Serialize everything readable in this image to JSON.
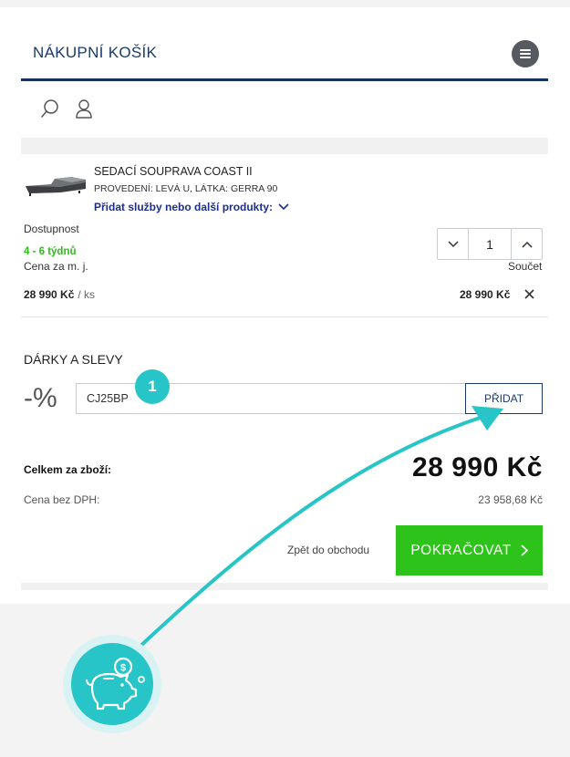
{
  "header": {
    "title": "NÁKUPNÍ KOŠÍK"
  },
  "product": {
    "name": "SEDACÍ SOUPRAVA COAST II",
    "variant": "PROVEDENÍ: LEVÁ U, LÁTKA: GERRA 90",
    "add_services": "Přidat služby nebo další produkty:",
    "availability_label": "Dostupnost",
    "availability_value": "4 - 6 týdnů",
    "quantity": "1",
    "unit_price_label": "Cena za m. j.",
    "unit_price": "28 990 Kč",
    "unit": "/ ks",
    "sum_label": "Součet",
    "sum_value": "28 990 Kč"
  },
  "discounts": {
    "title": "DÁRKY A SLEVY",
    "symbol": "-%",
    "coupon_value": "CJ25BP",
    "add_label": "PŘIDAT"
  },
  "totals": {
    "total_label": "Celkem za zboží:",
    "total_value": "28 990 Kč",
    "vat_label": "Cena bez DPH:",
    "vat_value": "23 958,68 Kč"
  },
  "actions": {
    "back_label": "Zpět do obchodu",
    "continue_label": "POKRAČOVAT"
  },
  "annotation": {
    "badge_number": "1"
  },
  "colors": {
    "brand_navy": "#1b3a6b",
    "accent_green": "#2ec31a",
    "availability_green": "#2ebd1b",
    "annotation_teal": "#27c5c8"
  },
  "icons": [
    "menu-icon",
    "search-icon",
    "user-icon",
    "chevron-down-icon",
    "chevron-up-icon",
    "close-icon",
    "chevron-right-icon",
    "piggy-bank-icon"
  ]
}
